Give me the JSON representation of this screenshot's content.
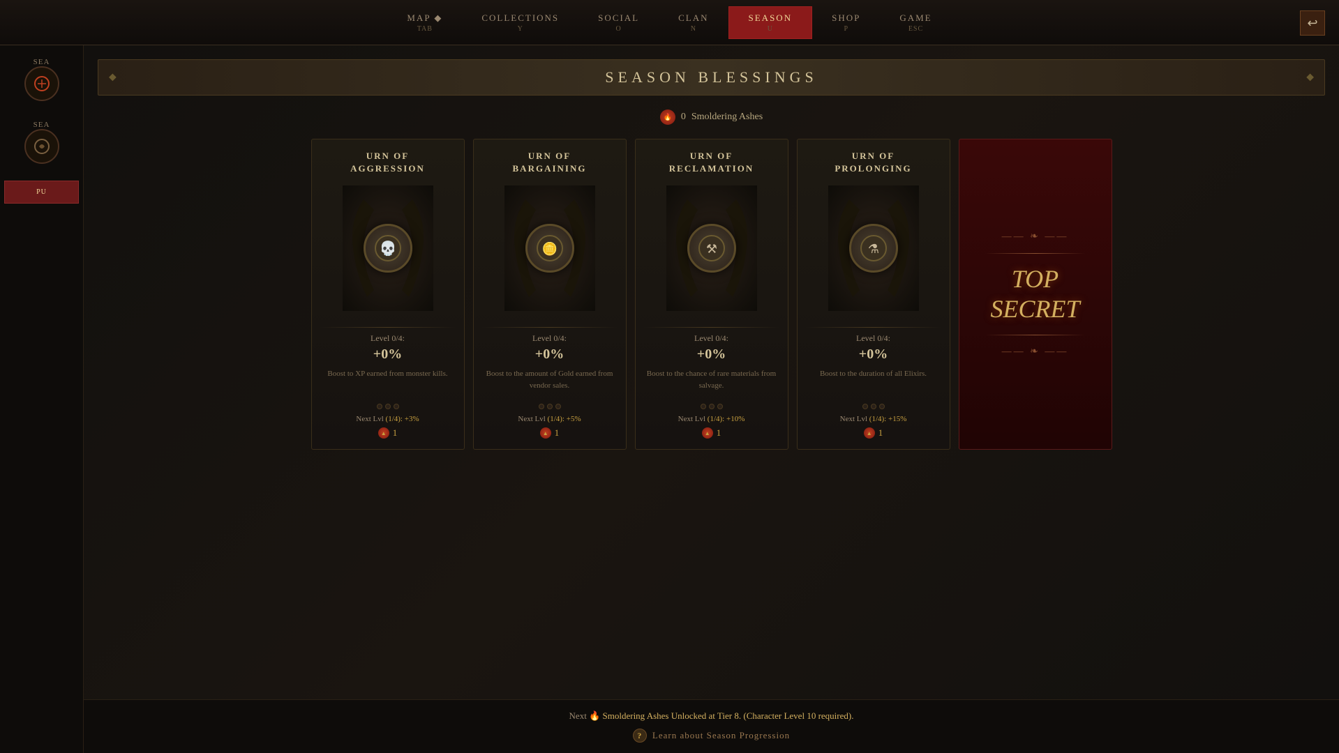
{
  "nav": {
    "items": [
      {
        "label": "MAP",
        "key": "TAB",
        "active": false
      },
      {
        "label": "COLLECTIONS",
        "key": "Y",
        "active": false
      },
      {
        "label": "SOCIAL",
        "key": "O",
        "active": false
      },
      {
        "label": "CLAN",
        "key": "N",
        "active": false
      },
      {
        "label": "SEASON",
        "key": "U",
        "active": true
      },
      {
        "label": "SHOP",
        "key": "P",
        "active": false
      },
      {
        "label": "GAME",
        "key": "ESC",
        "active": false
      }
    ]
  },
  "page_title": "SEASON BLESSINGS",
  "ashes": {
    "count": "0",
    "label": "Smoldering Ashes"
  },
  "sidebar": {
    "item1_label": "SEA",
    "item2_label": "SEA",
    "btn_label": "PU"
  },
  "cards": [
    {
      "title": "URN OF\nAGGRESSION",
      "level": "Level 0/4:",
      "bonus": "+0%",
      "description": "Boost to XP earned from monster kills.",
      "next_lvl": "Next Lvl (1/4): +3%",
      "cost": "1",
      "icon": "💀"
    },
    {
      "title": "URN OF\nBARGAINING",
      "level": "Level 0/4:",
      "bonus": "+0%",
      "description": "Boost to the amount of Gold earned from vendor sales.",
      "next_lvl": "Next Lvl (1/4): +5%",
      "cost": "1",
      "icon": "🪙"
    },
    {
      "title": "URN OF\nRECLAMATION",
      "level": "Level 0/4:",
      "bonus": "+0%",
      "description": "Boost to the chance of rare materials from salvage.",
      "next_lvl": "Next Lvl (1/4): +10%",
      "cost": "1",
      "icon": "⚒"
    },
    {
      "title": "URN OF\nPROLONGING",
      "level": "Level 0/4:",
      "bonus": "+0%",
      "description": "Boost to the duration of all Elixirs.",
      "next_lvl": "Next Lvl (1/4): +15%",
      "cost": "1",
      "icon": "⚗"
    }
  ],
  "secret_card": {
    "title": "TOP\nSECRET"
  },
  "footer": {
    "next_unlock": "Next",
    "next_unlock_detail": "Smoldering Ashes Unlocked at Tier 8.  (Character Level 10 required).",
    "learn_more": "Learn about Season Progression"
  }
}
